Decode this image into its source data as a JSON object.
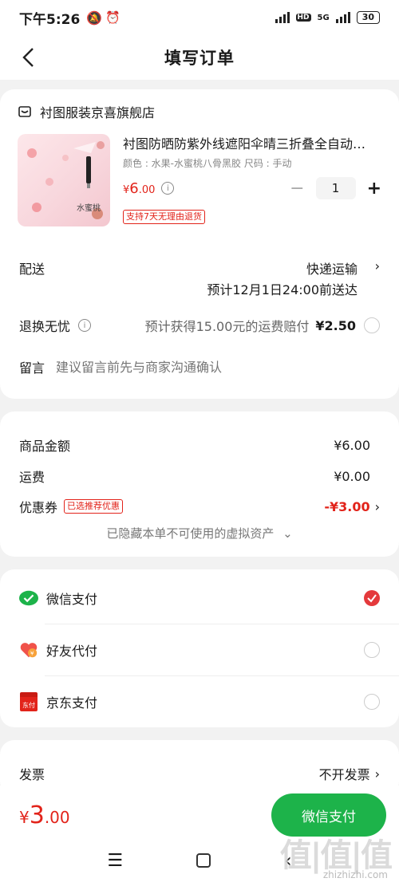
{
  "status_bar": {
    "time": "下午5:26",
    "network": "5G",
    "hd": "HD",
    "battery": "30"
  },
  "header": {
    "title": "填写订单"
  },
  "order_card": {
    "shop_name": "衬图服装京喜旗舰店",
    "product": {
      "name": "衬图防晒防紫外线遮阳伞晴三折叠全自动…",
      "spec": "颜色 : 水果-水蜜桃八骨黑胶    尺码 : 手动",
      "price_symbol": "¥",
      "price_int": "6",
      "price_dec": ".00",
      "quantity": "1",
      "return_tag": "支持7天无理由退货",
      "image_caption": "水蜜桃"
    },
    "delivery": {
      "label": "配送",
      "method": "快递运输",
      "eta": "预计12月1日24:00前送达"
    },
    "return_insurance": {
      "label": "退换无忧",
      "desc": "预计获得15.00元的运费赔付",
      "price": "¥2.50"
    },
    "remark": {
      "label": "留言",
      "placeholder": "建议留言前先与商家沟通确认"
    }
  },
  "price_card": {
    "goods_label": "商品金额",
    "goods_value": "¥6.00",
    "shipping_label": "运费",
    "shipping_value": "¥0.00",
    "coupon_label": "优惠券",
    "coupon_tag": "已选推荐优惠",
    "coupon_value": "-¥3.00",
    "hidden_note": "已隐藏本单不可使用的虚拟资产"
  },
  "payment_card": {
    "options": [
      {
        "label": "微信支付",
        "selected": true
      },
      {
        "label": "好友代付",
        "selected": false
      },
      {
        "label": "京东支付",
        "selected": false
      }
    ],
    "jd_icon_text": "东付"
  },
  "invoice": {
    "label": "发票",
    "value": "不开发票"
  },
  "bottom": {
    "symbol": "¥",
    "int": "3",
    "dec": ".00",
    "pay_button": "微信支付"
  },
  "watermark": {
    "logo": "值|值|值",
    "site": "zhizhizhi.com"
  },
  "colors": {
    "accent_red": "#e2231a",
    "wechat_green": "#1db34a",
    "background": "#f2f2f2"
  }
}
